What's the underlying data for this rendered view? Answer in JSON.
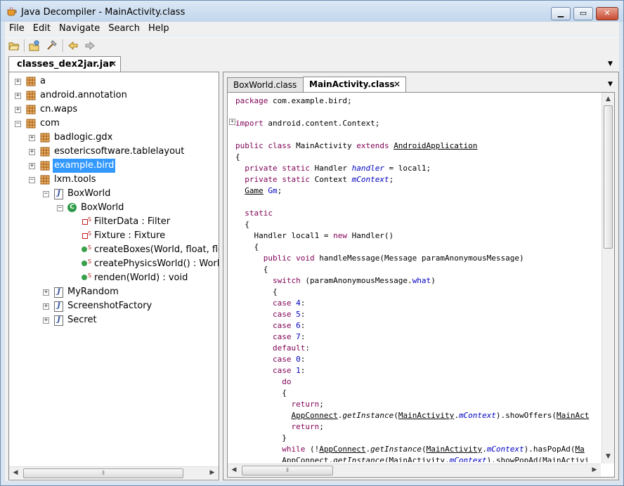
{
  "window": {
    "title": "Java Decompiler - MainActivity.class"
  },
  "menu": [
    "File",
    "Edit",
    "Navigate",
    "Search",
    "Help"
  ],
  "file_tab": {
    "label": "classes_dex2jar.jar",
    "close": "✕"
  },
  "tree": {
    "items": [
      {
        "label": "a"
      },
      {
        "label": "android.annotation"
      },
      {
        "label": "cn.waps"
      },
      {
        "label": "com"
      },
      {
        "label": "badlogic.gdx"
      },
      {
        "label": "esotericsoftware.tablelayout"
      },
      {
        "label": "example.bird"
      },
      {
        "label": "lxm.tools"
      },
      {
        "label": "BoxWorld"
      },
      {
        "label": "BoxWorld"
      },
      {
        "label": "FilterData : Filter"
      },
      {
        "label": "Fixture : Fixture"
      },
      {
        "label": "createBoxes(World, float, float"
      },
      {
        "label": "createPhysicsWorld() : World"
      },
      {
        "label": "renden(World) : void"
      },
      {
        "label": "MyRandom"
      },
      {
        "label": "ScreenshotFactory"
      },
      {
        "label": "Secret"
      }
    ],
    "selected": "example.bird"
  },
  "editor": {
    "tabs": [
      {
        "label": "BoxWorld.class"
      },
      {
        "label": "MainActivity.class",
        "close": "✕"
      }
    ],
    "active_tab": "MainActivity.class",
    "code_lines": [
      "package com.example.bird;",
      "",
      "import android.content.Context;",
      "",
      "public class MainActivity extends AndroidApplication",
      "{",
      "  private static Handler handler = local1;",
      "  private static Context mContext;",
      "  Game Gm;",
      "",
      "  static",
      "  {",
      "    Handler local1 = new Handler()",
      "    {",
      "      public void handleMessage(Message paramAnonymousMessage)",
      "      {",
      "        switch (paramAnonymousMessage.what)",
      "        {",
      "        case 4:",
      "        case 5:",
      "        case 6:",
      "        case 7:",
      "        default:",
      "        case 0:",
      "        case 1:",
      "          do",
      "          {",
      "            return;",
      "            AppConnect.getInstance(MainActivity.mContext).showOffers(MainAct",
      "            return;",
      "          }",
      "          while (!AppConnect.getInstance(MainActivity.mContext).hasPopAd(Ma",
      "          AppConnect.getInstance(MainActivity.mContext).showPopAd(MainActivi"
    ]
  },
  "colors": {
    "keyword": "#7f0055",
    "field": "#0000c0",
    "selection": "#3399ff"
  }
}
